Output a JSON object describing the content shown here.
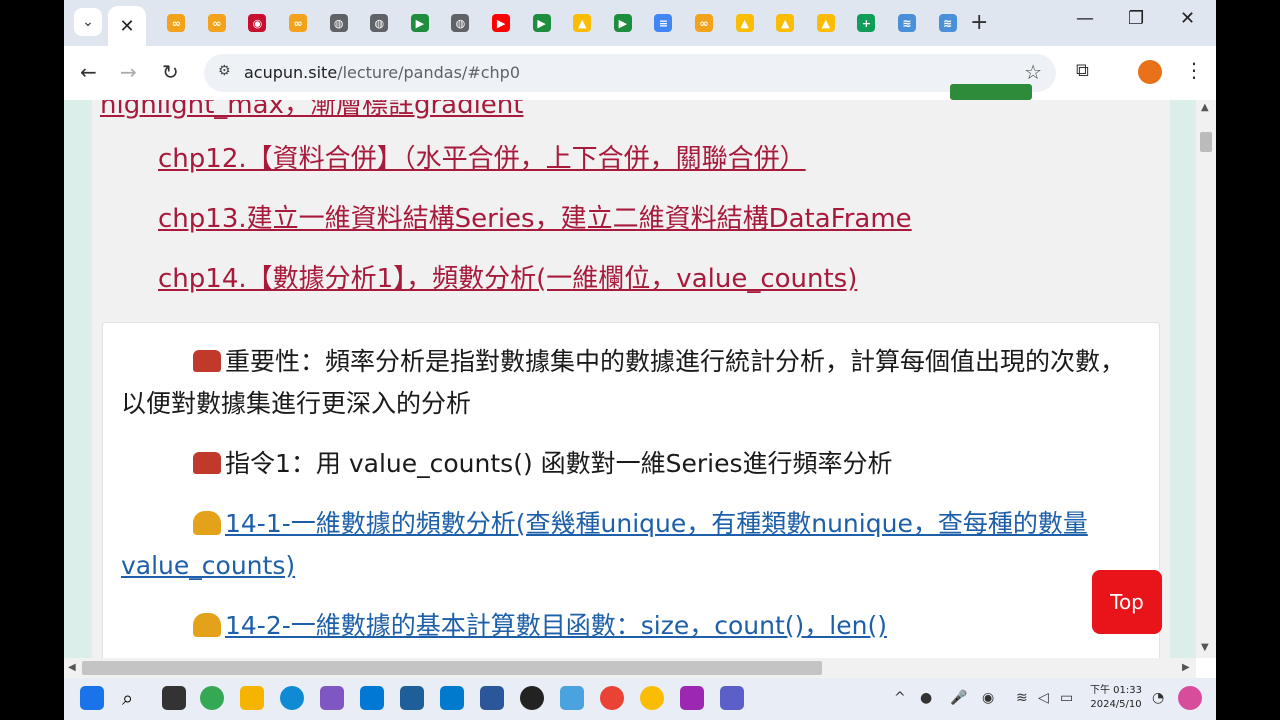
{
  "browser": {
    "tab_close": "✕",
    "new_tab": "+",
    "url_host": "acupun.site",
    "url_path": "/lecture/pandas/#chp0",
    "win_min": "—",
    "win_max": "❐",
    "win_close": "✕",
    "tab_favicons": [
      {
        "icon": "infinity-icon",
        "color": "#f2a31b",
        "glyph": "∞"
      },
      {
        "icon": "infinity-icon",
        "color": "#f2a31b",
        "glyph": "∞"
      },
      {
        "icon": "record-icon",
        "color": "#c8102e",
        "glyph": "◉"
      },
      {
        "icon": "infinity-icon",
        "color": "#f2a31b",
        "glyph": "∞"
      },
      {
        "icon": "globe-icon",
        "color": "#5f6368",
        "glyph": "◍"
      },
      {
        "icon": "globe-icon",
        "color": "#5f6368",
        "glyph": "◍"
      },
      {
        "icon": "meet-icon",
        "color": "#1e8e3e",
        "glyph": "▶"
      },
      {
        "icon": "globe-icon",
        "color": "#5f6368",
        "glyph": "◍"
      },
      {
        "icon": "youtube-icon",
        "color": "#ff0000",
        "glyph": "▶"
      },
      {
        "icon": "meet-icon",
        "color": "#1e8e3e",
        "glyph": "▶"
      },
      {
        "icon": "drive-icon",
        "color": "#fbbc04",
        "glyph": "▲"
      },
      {
        "icon": "meet-icon",
        "color": "#1e8e3e",
        "glyph": "▶"
      },
      {
        "icon": "docs-icon",
        "color": "#4285f4",
        "glyph": "≡"
      },
      {
        "icon": "infinity-icon",
        "color": "#f2a31b",
        "glyph": "∞"
      },
      {
        "icon": "drive-icon",
        "color": "#fbbc04",
        "glyph": "▲"
      },
      {
        "icon": "drive-icon",
        "color": "#fbbc04",
        "glyph": "▲"
      },
      {
        "icon": "drive-icon",
        "color": "#fbbc04",
        "glyph": "▲"
      },
      {
        "icon": "sheets-plus-icon",
        "color": "#0f9d58",
        "glyph": "+"
      },
      {
        "icon": "wifi-hand-icon",
        "color": "#4a90d9",
        "glyph": "≋"
      },
      {
        "icon": "wifi-hand-icon",
        "color": "#4a90d9",
        "glyph": "≋"
      }
    ]
  },
  "content": {
    "top_partial_link": "highlight_max，漸層標註gradient",
    "links": [
      "chp12.【資料合併】（水平合併，上下合併，關聯合併）",
      "chp13.建立一維資料結構Series，建立二維資料結構DataFrame",
      "chp14.【數據分析1】，頻數分析(一維欄位，value_counts)"
    ],
    "importance": "重要性：頻率分析是指對數據集中的數據進行統計分析，計算每個值出現的次數，以便對數據集進行更深入的分析",
    "command1": "指令1：用 value_counts() 函數對一維Series進行頻率分析",
    "sub_links": [
      "14-1-一維數據的頻數分析(查幾種unique，有種類數nunique，查每種的數量value_counts)",
      "14-2-一維數據的基本計算數目函數：size，count()，len()"
    ],
    "top_button": "Top"
  },
  "taskbar": {
    "time": "下午 01:33",
    "date": "2024/5/10"
  }
}
